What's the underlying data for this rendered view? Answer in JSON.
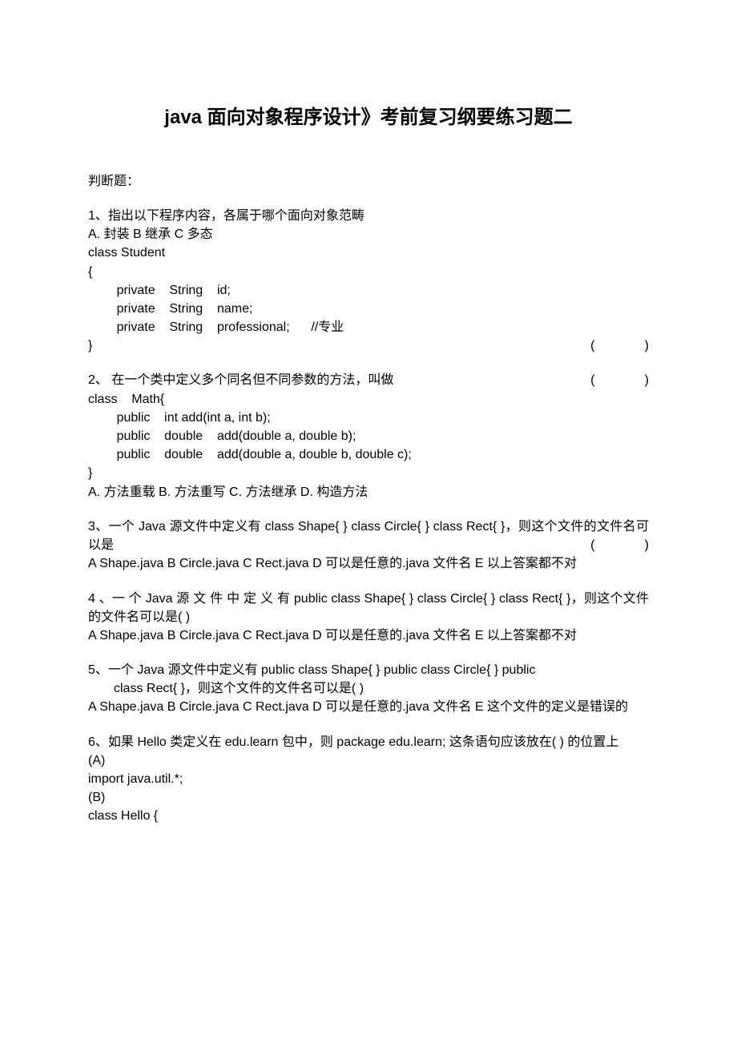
{
  "title": "java 面向对象程序设计》考前复习纲要练习题二",
  "section_label": "判断题：",
  "q1": {
    "prompt": "1、指出以下程序内容，各属于哪个面向对象范畴",
    "opts": "A.    封装                    B    继承                        C  多态",
    "code": [
      "class    Student",
      "{",
      "        private    String    id;",
      "        private    String    name;",
      "        private    String    professional;      //专业",
      "}"
    ],
    "paren": "(              )"
  },
  "q2": {
    "line1": "2、  在一个类中定义多个同名但不同参数的方法，叫做",
    "paren": "(              )",
    "code": [
      "class    Math{",
      "        public    int add(int a, int b);",
      "        public    double    add(double a, double b);",
      "        public    double    add(double a, double b, double c);",
      "}"
    ],
    "opts": "A. 方法重载          B. 方法重写            C. 方法继承            D. 构造方法"
  },
  "q3": {
    "line1": "3、一个 Java 源文件中定义有 class    Shape{    }      class    Circle{    }      class    Rect{        }，则这个文件的文件名可以是",
    "paren": "(              )",
    "opts": "A Shape.java          B Circle.java          C Rect.java       D 可以是任意的.java 文件名       E 以上答案都不对"
  },
  "q4": {
    "line1": "4 、一 个 Java 源 文 件 中 定 义 有 public    class    Shape{    }      class    Circle{    }      class    Rect{        }，则这个文件的文件名可以是(              )",
    "opts": "A Shape.java          B Circle.java          C Rect.java       D 可以是任意的.java 文件名       E 以上答案都不对"
  },
  "q5": {
    "line1a": "5、一个 Java 源文件中定义有 public    class    Shape{    }      public    class    Circle{    }      public",
    "line1b": "class    Rect{        }，则这个文件的文件名可以是(              )",
    "opts": "A Shape.java          B Circle.java          C Rect.java       D 可以是任意的.java 文件名       E 这个文件的定义是错误的"
  },
  "q6": {
    "line1": "6、如果 Hello 类定义在 edu.learn 包中，则 package    edu.learn;  这条语句应该放在(              ) 的位置上",
    "code": [
      "(A)",
      "import    java.util.*;",
      "(B)",
      "class    Hello {"
    ]
  }
}
